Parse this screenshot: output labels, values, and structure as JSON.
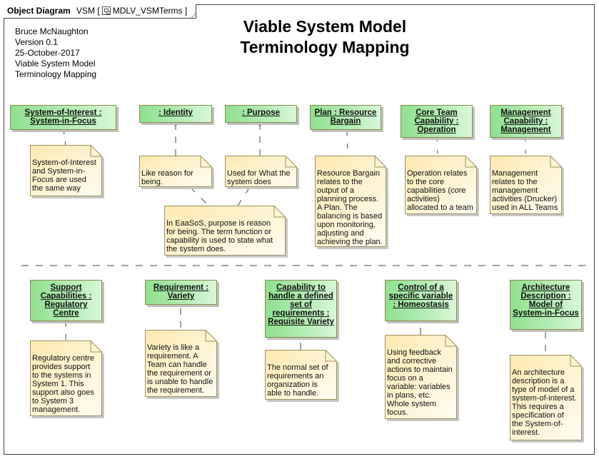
{
  "frame": {
    "kind": "Object Diagram",
    "package": "VSM",
    "diagram_icon": "diagram-icon",
    "diagram_name": "MDLV_VSMTerms"
  },
  "meta": {
    "lines": [
      "Bruce McNaughton",
      "Version 0.1",
      "25-October-2017",
      "Viable System Model",
      "Terminology Mapping"
    ]
  },
  "title": {
    "line1": "Viable System Model",
    "line2": "Terminology Mapping"
  },
  "colors": {
    "instance_fill_start": "#8fe08f",
    "instance_fill_end": "#d8f7d8",
    "instance_border": "#8c8c4a",
    "note_fill_start": "#fde9b0",
    "note_fill_end": "#fffdf2",
    "note_border": "#a09060",
    "frame_border": "#404040"
  },
  "instances": [
    {
      "label": "System-of-Interest : System-in-Focus"
    },
    {
      "label": ": Identity"
    },
    {
      "label": ": Purpose"
    },
    {
      "label": "Plan : Resource Bargain"
    },
    {
      "label": "Core Team Capability : Operation"
    },
    {
      "label": "Management Capability : Management"
    },
    {
      "label": "Support Capabilities : Regulatory Centre"
    },
    {
      "label": "Requirement : Variety"
    },
    {
      "label": "Capability to handle a defined set of requirements : Requisite Variety"
    },
    {
      "label": "Control of a specific variable : Homeostasis"
    },
    {
      "label": "Architecture Description : Model of System-in-Focus"
    }
  ],
  "notes": [
    {
      "text": "System-of-Interest\nand System-in-\nFocus are used\nthe same way"
    },
    {
      "text": "Like reason for\nbeing."
    },
    {
      "text": "Used for What the\nsystem does"
    },
    {
      "text": "Resource Bargain\nrelates to the\noutput of a\nplanning process.\nA Plan.  The\nbalancing is based\nupon monitoring,\nadjusting and\nachieving the plan."
    },
    {
      "text": "Operation relates\nto the core\ncapabilities (core\nactivities)\nallocated to a team"
    },
    {
      "text": "Management\nrelates to the\nmanagement\nactivities (Drucker)\nused in ALL Teams"
    },
    {
      "text": "In EaaSoS, purpose is reason\nfor being.  The term function or\ncapability is used to state what\nthe system does."
    },
    {
      "text": "Regulatory centre\nprovides support\nto the systems in\nSystem 1.  This\nsupport also goes\nto System 3\nmanagement."
    },
    {
      "text": "Variety is like a\nrequirement.  A\nTeam can handle\nthe requirement or\nis unable to handle\nthe requirement."
    },
    {
      "text": "The normal set of\nrequirements an\norganization is\nable to handle."
    },
    {
      "text": "Using feedback\nand corrective\nactions to maintain\nfocus on a\nvariable:  variables\nin plans, etc.\nWhole system\nfocus."
    },
    {
      "text": "An architecture\ndescription is a\ntype of model of a\nsystem-of-interest.\n  This requires a\nspecification of\nthe System-of-\ninterest."
    }
  ]
}
